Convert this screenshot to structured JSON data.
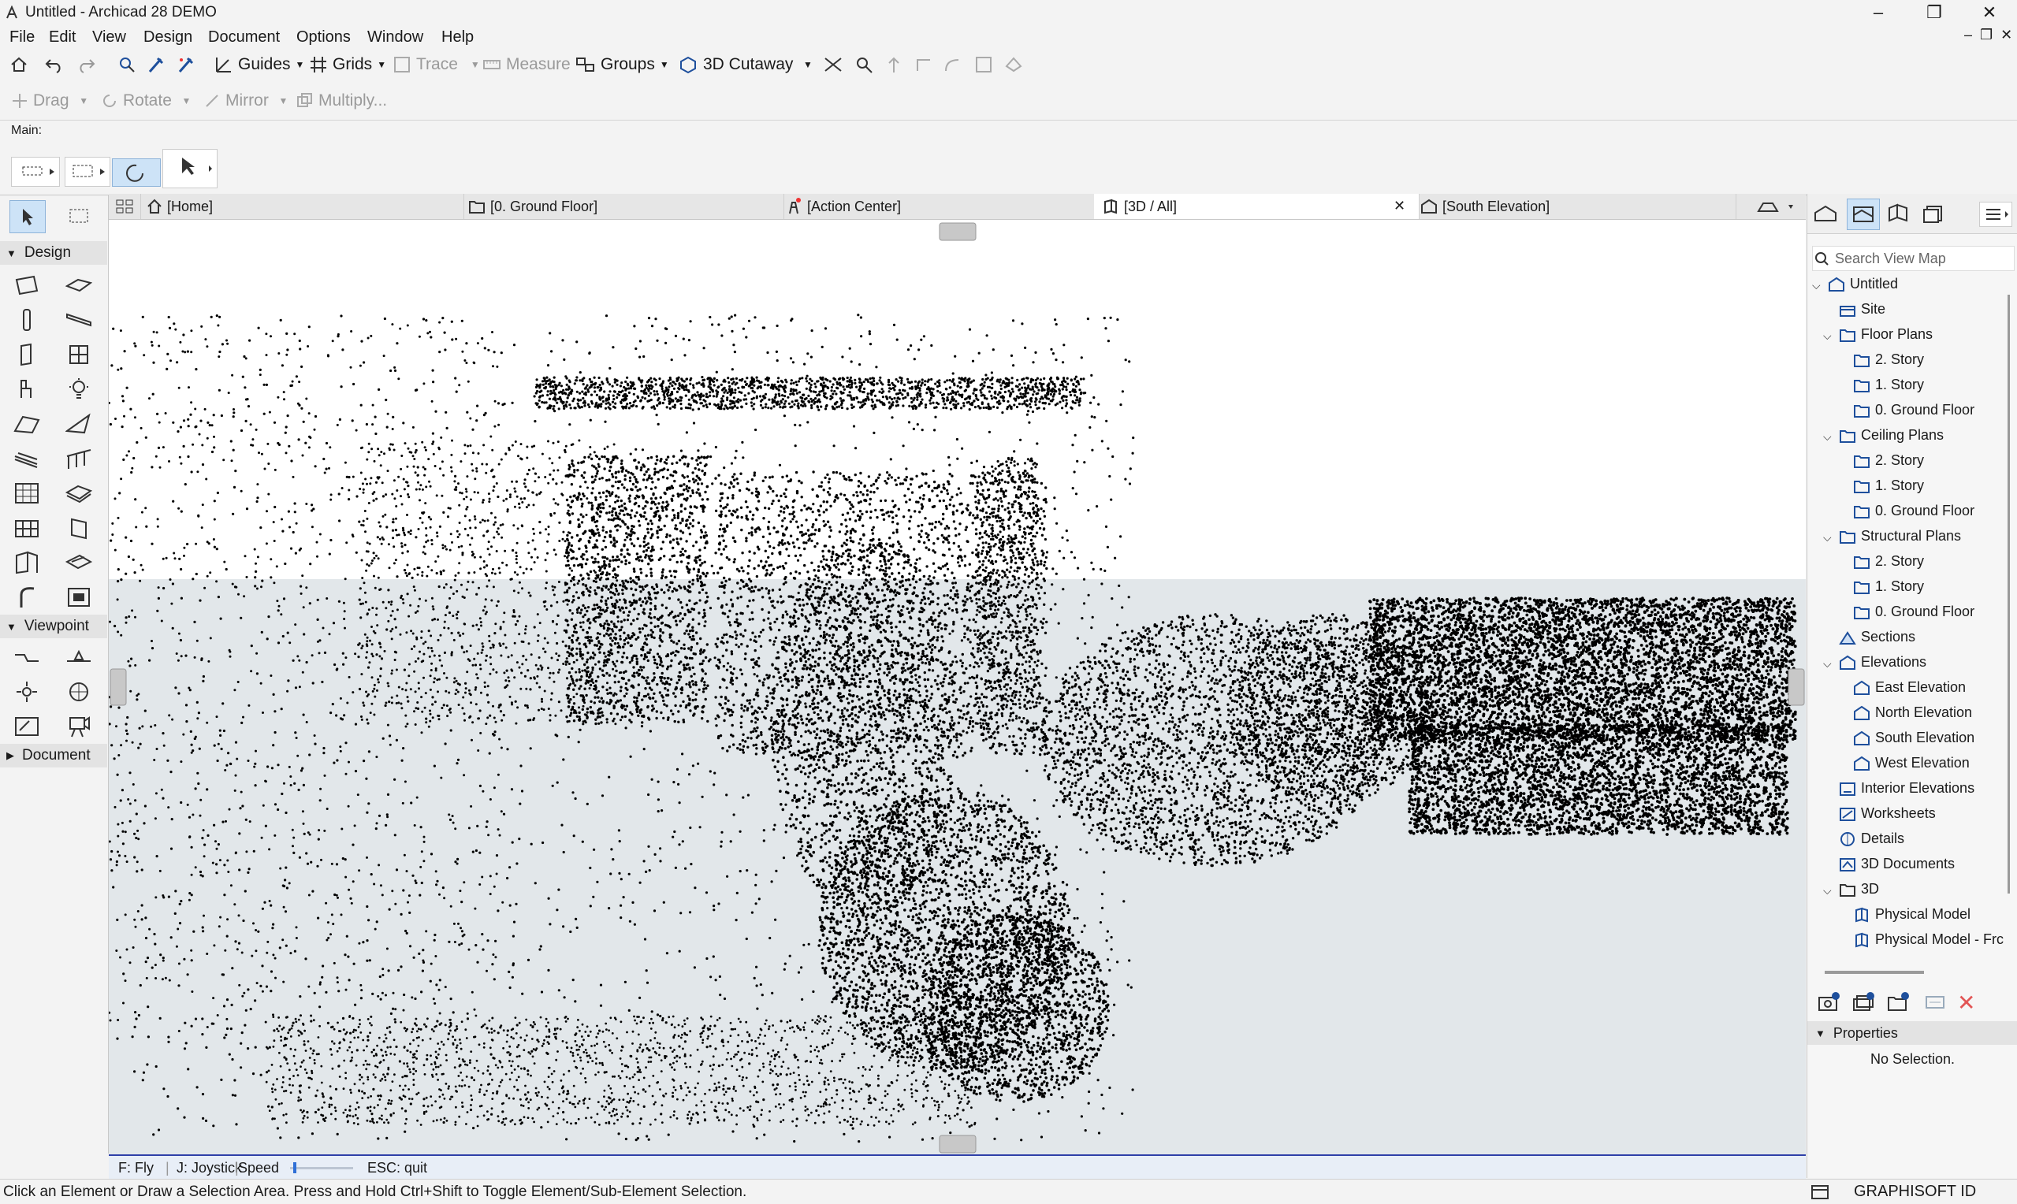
{
  "window": {
    "title": "Untitled - Archicad 28 DEMO",
    "min": "–",
    "max": "❐",
    "close": "✕"
  },
  "menus": [
    "File",
    "Edit",
    "View",
    "Design",
    "Document",
    "Options",
    "Window",
    "Help"
  ],
  "toolbar1": {
    "guides": "Guides",
    "grids": "Grids",
    "trace": "Trace",
    "measure": "Measure",
    "groups": "Groups",
    "cutaway": "3D Cutaway"
  },
  "toolbar2": {
    "drag": "Drag",
    "rotate": "Rotate",
    "mirror": "Mirror",
    "multiply": "Multiply..."
  },
  "infobox": {
    "label": "Main:"
  },
  "toolbox": {
    "design": "Design",
    "viewpoint": "Viewpoint",
    "document": "Document"
  },
  "tabs": [
    "[Home]",
    "[0. Ground Floor]",
    "[Action Center]",
    "[3D / All]",
    "[South Elevation]"
  ],
  "nav": {
    "fly": "F: Fly",
    "joystick": "J: Joystick",
    "speed": "Speed",
    "esc": "ESC: quit",
    "speed_level": 0.05
  },
  "viewmap": {
    "search_placeholder": "Search View Map",
    "items": [
      {
        "label": "Untitled"
      },
      {
        "label": "Site"
      },
      {
        "label": "Floor Plans"
      },
      {
        "label": "2. Story"
      },
      {
        "label": "1. Story"
      },
      {
        "label": "0. Ground Floor"
      },
      {
        "label": "Ceiling Plans"
      },
      {
        "label": "2. Story"
      },
      {
        "label": "1. Story"
      },
      {
        "label": "0. Ground Floor"
      },
      {
        "label": "Structural Plans"
      },
      {
        "label": "2. Story"
      },
      {
        "label": "1. Story"
      },
      {
        "label": "0. Ground Floor"
      },
      {
        "label": "Sections"
      },
      {
        "label": "Elevations"
      },
      {
        "label": "East Elevation"
      },
      {
        "label": "North Elevation"
      },
      {
        "label": "South Elevation"
      },
      {
        "label": "West Elevation"
      },
      {
        "label": "Interior Elevations"
      },
      {
        "label": "Worksheets"
      },
      {
        "label": "Details"
      },
      {
        "label": "3D Documents"
      },
      {
        "label": "3D"
      },
      {
        "label": "Physical Model"
      },
      {
        "label": "Physical Model - Frc"
      }
    ]
  },
  "properties": {
    "title": "Properties",
    "empty": "No Selection."
  },
  "status": {
    "message": "Click an Element or Draw a Selection Area. Press and Hold Ctrl+Shift to Toggle Element/Sub-Element Selection.",
    "brand": "GRAPHISOFT ID"
  },
  "colors": {
    "accent": "#2f3fa8",
    "icon_blue": "#1e4f9c",
    "sky": "#ffffff",
    "ground": "#e2e7ea",
    "points": "#000000"
  }
}
